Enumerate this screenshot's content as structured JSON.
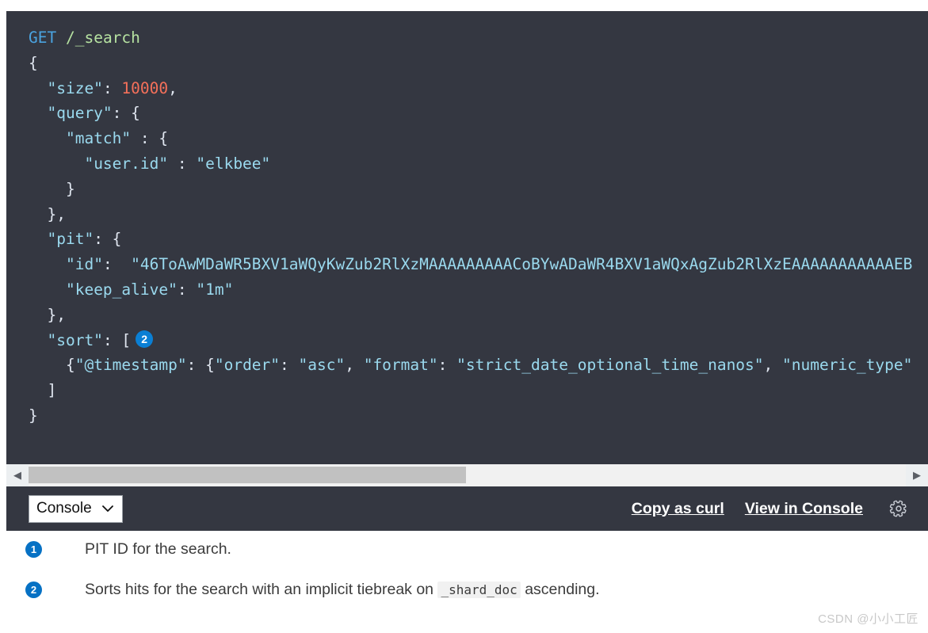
{
  "code_block": {
    "request_method": "GET",
    "request_path": "/_search",
    "lines": [
      {
        "indent": 0,
        "segments": [
          {
            "t": "method",
            "v": "GET"
          },
          {
            "t": "plain",
            "v": " "
          },
          {
            "t": "path",
            "v": "/_search"
          }
        ]
      },
      {
        "indent": 0,
        "segments": [
          {
            "t": "punct",
            "v": "{"
          }
        ]
      },
      {
        "indent": 1,
        "segments": [
          {
            "t": "key",
            "v": "\"size\""
          },
          {
            "t": "punct",
            "v": ": "
          },
          {
            "t": "num",
            "v": "10000"
          },
          {
            "t": "punct",
            "v": ","
          }
        ]
      },
      {
        "indent": 1,
        "segments": [
          {
            "t": "key",
            "v": "\"query\""
          },
          {
            "t": "punct",
            "v": ": {"
          }
        ]
      },
      {
        "indent": 2,
        "segments": [
          {
            "t": "key",
            "v": "\"match\""
          },
          {
            "t": "punct",
            "v": " : {"
          }
        ]
      },
      {
        "indent": 3,
        "segments": [
          {
            "t": "key",
            "v": "\"user.id\""
          },
          {
            "t": "punct",
            "v": " : "
          },
          {
            "t": "string",
            "v": "\"elkbee\""
          }
        ]
      },
      {
        "indent": 2,
        "segments": [
          {
            "t": "punct",
            "v": "}"
          }
        ]
      },
      {
        "indent": 1,
        "segments": [
          {
            "t": "punct",
            "v": "},"
          }
        ]
      },
      {
        "indent": 1,
        "segments": [
          {
            "t": "key",
            "v": "\"pit\""
          },
          {
            "t": "punct",
            "v": ": {"
          }
        ]
      },
      {
        "indent": 2,
        "segments": [
          {
            "t": "key",
            "v": "\"id\""
          },
          {
            "t": "punct",
            "v": ":  "
          },
          {
            "t": "string",
            "v": "\"46ToAwMDaWR5BXV1aWQyKwZub2RlXzMAAAAAAAAACoBYwADaWR4BXV1aWQxAgZub2RlXzEAAAAAAAAAAAEB"
          }
        ]
      },
      {
        "indent": 2,
        "segments": [
          {
            "t": "key",
            "v": "\"keep_alive\""
          },
          {
            "t": "punct",
            "v": ": "
          },
          {
            "t": "string",
            "v": "\"1m\""
          }
        ]
      },
      {
        "indent": 1,
        "segments": [
          {
            "t": "punct",
            "v": "},"
          }
        ]
      },
      {
        "indent": 1,
        "segments": [
          {
            "t": "key",
            "v": "\"sort\""
          },
          {
            "t": "punct",
            "v": ": ["
          },
          {
            "t": "badge",
            "v": "2"
          }
        ]
      },
      {
        "indent": 2,
        "segments": [
          {
            "t": "punct",
            "v": "{"
          },
          {
            "t": "key",
            "v": "\"@timestamp\""
          },
          {
            "t": "punct",
            "v": ": {"
          },
          {
            "t": "key",
            "v": "\"order\""
          },
          {
            "t": "punct",
            "v": ": "
          },
          {
            "t": "string",
            "v": "\"asc\""
          },
          {
            "t": "punct",
            "v": ", "
          },
          {
            "t": "key",
            "v": "\"format\""
          },
          {
            "t": "punct",
            "v": ": "
          },
          {
            "t": "string",
            "v": "\"strict_date_optional_time_nanos\""
          },
          {
            "t": "punct",
            "v": ", "
          },
          {
            "t": "key",
            "v": "\"numeric_type\""
          }
        ]
      },
      {
        "indent": 1,
        "segments": [
          {
            "t": "punct",
            "v": "]"
          }
        ]
      },
      {
        "indent": 0,
        "segments": [
          {
            "t": "punct",
            "v": "}"
          }
        ]
      }
    ]
  },
  "scrollbar": {
    "left_arrow": "◀",
    "right_arrow": "▶"
  },
  "actionbar": {
    "select_value": "Console",
    "select_options": [
      "Console"
    ],
    "caret": "❯",
    "copy_as_curl": "Copy as curl",
    "view_in_console": "View in Console",
    "gear_title": "Settings"
  },
  "footnotes": [
    {
      "number": "1",
      "text": "PIT ID for the search.",
      "code": null,
      "text_after": null
    },
    {
      "number": "2",
      "text": "Sorts hits for the search with an implicit tiebreak on ",
      "code": "_shard_doc",
      "text_after": " ascending."
    }
  ],
  "watermark": "CSDN @小小工匠",
  "colors": {
    "panel_bg": "#343741",
    "method": "#4aa3e0",
    "path": "#b6e2a1",
    "key": "#9ad9ee",
    "string": "#9ad9ee",
    "number": "#f5705a",
    "punct": "#dfe5ef",
    "badge": "#0a7fd4",
    "footnote_badge": "#0671c4"
  }
}
